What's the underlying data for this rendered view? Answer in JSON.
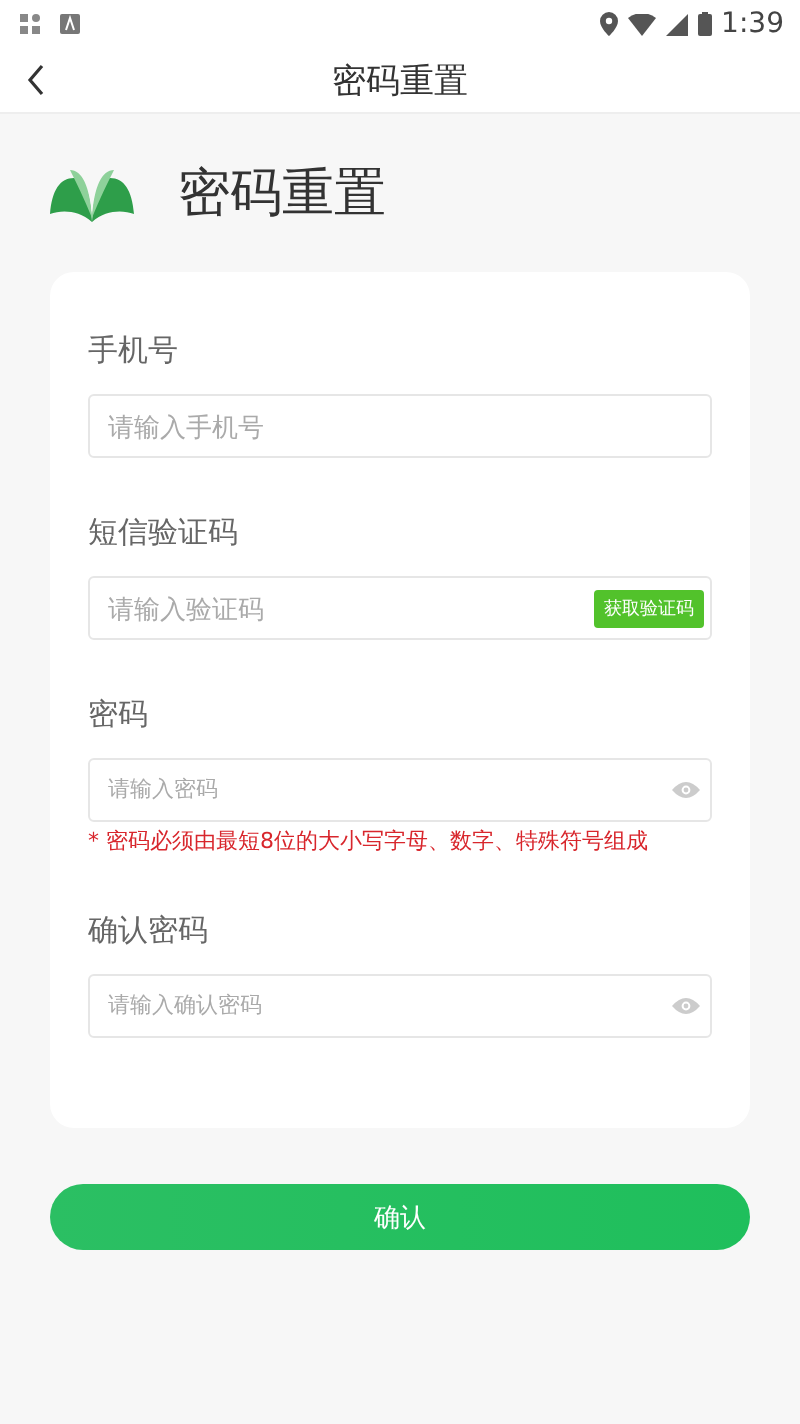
{
  "status_bar": {
    "time": "1:39"
  },
  "nav_bar": {
    "title": "密码重置"
  },
  "header": {
    "title": "密码重置"
  },
  "form": {
    "fields": [
      {
        "kind": "text",
        "label": "手机号",
        "placeholder": "请输入手机号"
      },
      {
        "kind": "code",
        "label": "短信验证码",
        "placeholder": "请输入验证码",
        "button": "获取验证码"
      },
      {
        "kind": "password",
        "label": "密码",
        "placeholder": "请输入密码",
        "hint": "* 密码必须由最短8位的大小写字母、数字、特殊符号组成"
      },
      {
        "kind": "password",
        "label": "确认密码",
        "placeholder": "请输入确认密码"
      }
    ]
  },
  "confirm_button": "确认"
}
